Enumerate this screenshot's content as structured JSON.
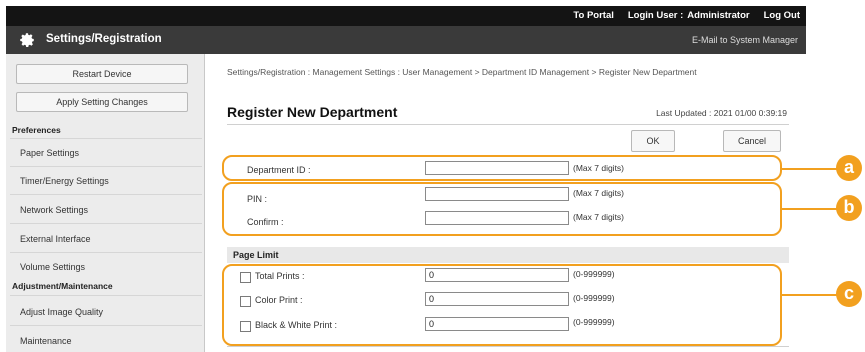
{
  "header": {
    "portal_link": "To Portal",
    "login_label": "Login User :",
    "login_user": "Administrator",
    "logout_link": "Log Out",
    "app_title": "Settings/Registration",
    "mail_link": "E-Mail to System Manager"
  },
  "sidebar": {
    "restart_button": "Restart Device",
    "apply_button": "Apply Setting Changes",
    "preferences_heading": "Preferences",
    "preferences_items": [
      "Paper Settings",
      "Timer/Energy Settings",
      "Network Settings",
      "External Interface",
      "Volume Settings"
    ],
    "adjustment_heading": "Adjustment/Maintenance",
    "adjustment_items": [
      "Adjust Image Quality",
      "Maintenance"
    ]
  },
  "main": {
    "breadcrumb": "Settings/Registration : Management Settings : User Management > Department ID Management > Register New Department",
    "page_title": "Register New Department",
    "last_updated": "Last Updated : 2021 01/00 0:39:19",
    "ok_button": "OK",
    "cancel_button": "Cancel",
    "department_id": {
      "label": "Department ID :",
      "value": "",
      "note": "(Max 7 digits)"
    },
    "pin": {
      "label": "PIN :",
      "value": "",
      "note": "(Max 7 digits)"
    },
    "confirm": {
      "label": "Confirm :",
      "value": "",
      "note": "(Max 7 digits)"
    },
    "page_limit": {
      "heading": "Page Limit",
      "rows": [
        {
          "label": "Total Prints :",
          "value": "0",
          "note": "(0-999999)",
          "checked": false
        },
        {
          "label": "Color Print :",
          "value": "0",
          "note": "(0-999999)",
          "checked": false
        },
        {
          "label": "Black & White Print :",
          "value": "0",
          "note": "(0-999999)",
          "checked": false
        }
      ]
    }
  },
  "callouts": {
    "a": "a",
    "b": "b",
    "c": "c"
  },
  "colors": {
    "accent": "#f2a01f",
    "topbar": "#141414",
    "titlebar": "#3a3a3a"
  },
  "icons": {
    "settings": "gear-icon"
  }
}
